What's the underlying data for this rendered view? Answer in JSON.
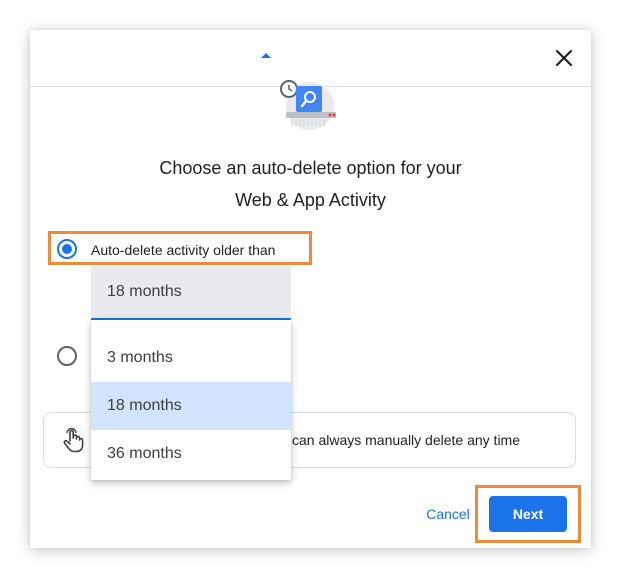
{
  "dialog": {
    "heading_line1": "Choose an auto-delete option for your",
    "heading_line2": "Web & App Activity",
    "close_icon": "close-icon"
  },
  "options": {
    "auto_delete_label": "Auto-delete activity older than",
    "auto_delete_checked": true,
    "second_checked": false
  },
  "dropdown": {
    "selected_value": "18 months",
    "items": [
      "3 months",
      "18 months",
      "36 months"
    ]
  },
  "info": {
    "text": "can always manually delete any time",
    "icon": "hand-touch-icon"
  },
  "footer": {
    "cancel_label": "Cancel",
    "next_label": "Next"
  },
  "colors": {
    "accent": "#1a73e8",
    "highlight_frame": "#ef8a3a",
    "selected_item_bg": "#d2e3fc"
  }
}
